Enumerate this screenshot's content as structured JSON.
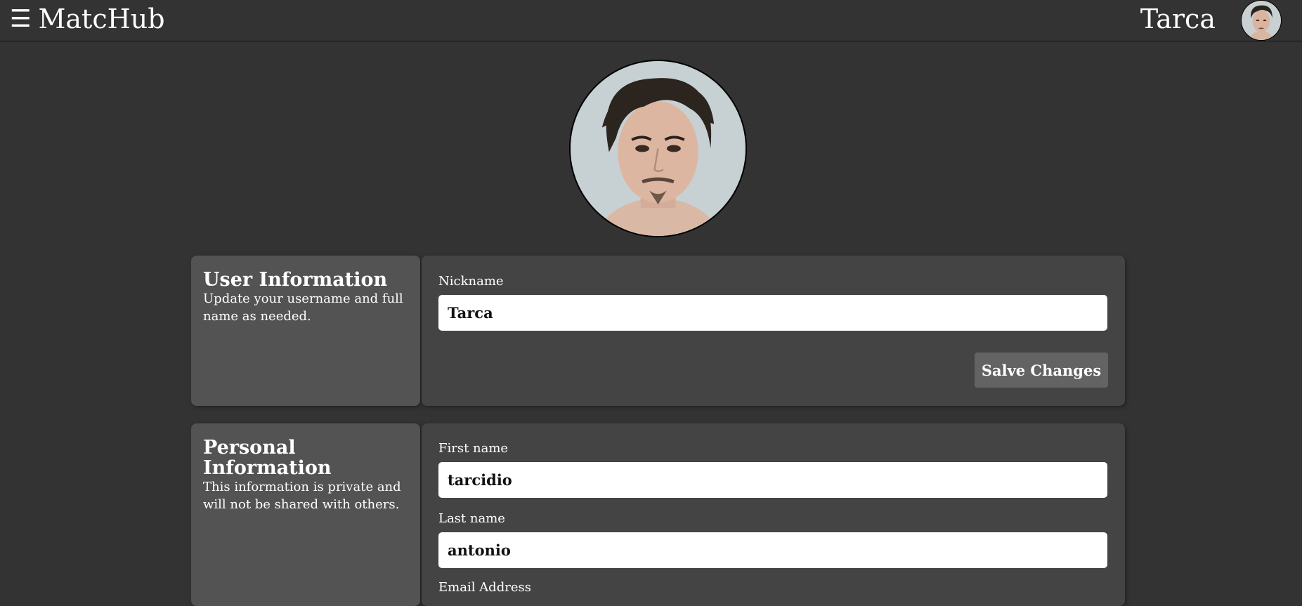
{
  "header": {
    "menu_icon": "☰",
    "brand": "MatcHub",
    "user_name": "Tarca"
  },
  "user_information": {
    "title": "User Information",
    "description": "Update your username and full name as needed.",
    "nickname_label": "Nickname",
    "nickname_value": "Tarca",
    "save_label": "Salve Changes"
  },
  "personal_information": {
    "title": "Personal Information",
    "description": "This information is private and will not be shared with others.",
    "first_name_label": "First name",
    "first_name_value": "tarcidio",
    "last_name_label": "Last name",
    "last_name_value": "antonio",
    "email_label": "Email Address"
  },
  "colors": {
    "background": "#333333",
    "side_panel": "#535353",
    "main_panel": "#444444",
    "button": "#636363"
  }
}
